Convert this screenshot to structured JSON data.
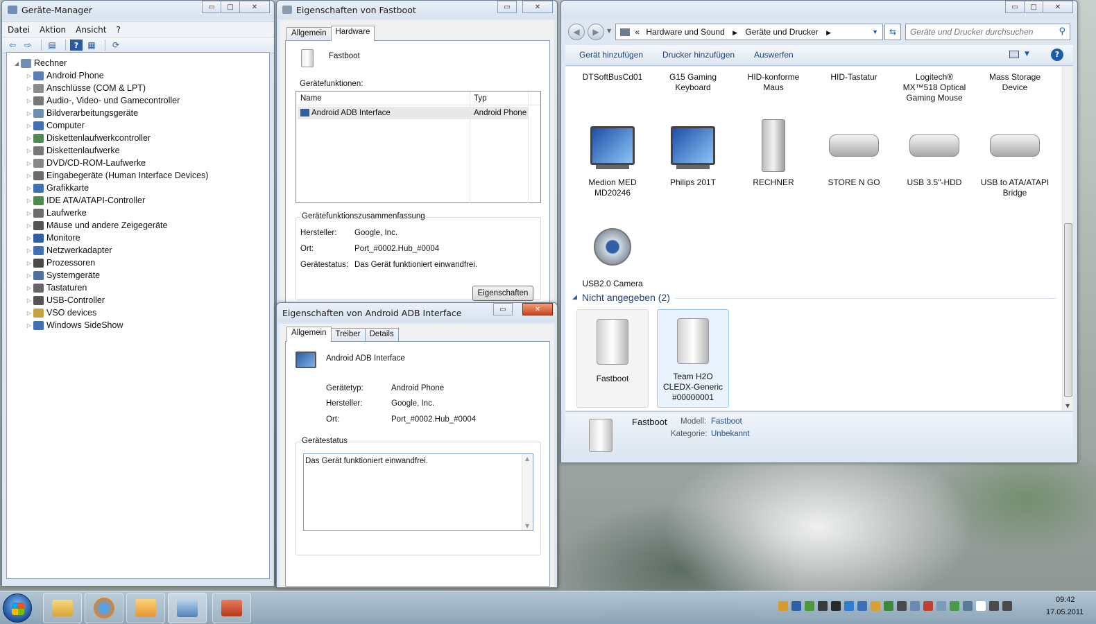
{
  "device_manager": {
    "title": "Geräte-Manager",
    "menu": [
      "Datei",
      "Aktion",
      "Ansicht",
      "?"
    ],
    "root": "Rechner",
    "items": [
      {
        "label": "Android Phone",
        "icon": "android-phone-icon",
        "color": "#5a7fb3"
      },
      {
        "label": "Anschlüsse (COM & LPT)",
        "icon": "port-icon",
        "color": "#8a8a8a"
      },
      {
        "label": "Audio-, Video- und Gamecontroller",
        "icon": "speaker-icon",
        "color": "#777777"
      },
      {
        "label": "Bildverarbeitungsgeräte",
        "icon": "camera-icon",
        "color": "#6d8fb4"
      },
      {
        "label": "Computer",
        "icon": "computer-icon",
        "color": "#3f6fb5"
      },
      {
        "label": "Diskettenlaufwerkcontroller",
        "icon": "controller-icon",
        "color": "#4f8a4f"
      },
      {
        "label": "Diskettenlaufwerke",
        "icon": "floppy-icon",
        "color": "#777777"
      },
      {
        "label": "DVD/CD-ROM-Laufwerke",
        "icon": "disc-drive-icon",
        "color": "#888888"
      },
      {
        "label": "Eingabegeräte (Human Interface Devices)",
        "icon": "hid-icon",
        "color": "#6b6b6b"
      },
      {
        "label": "Grafikkarte",
        "icon": "display-adapter-icon",
        "color": "#3f6fb5"
      },
      {
        "label": "IDE ATA/ATAPI-Controller",
        "icon": "ide-icon",
        "color": "#4f8a4f"
      },
      {
        "label": "Laufwerke",
        "icon": "drive-icon",
        "color": "#6d6d6d"
      },
      {
        "label": "Mäuse und andere Zeigegeräte",
        "icon": "mouse-icon",
        "color": "#555555"
      },
      {
        "label": "Monitore",
        "icon": "monitor-icon",
        "color": "#2f5fa5"
      },
      {
        "label": "Netzwerkadapter",
        "icon": "network-icon",
        "color": "#3f6fb5"
      },
      {
        "label": "Prozessoren",
        "icon": "processor-icon",
        "color": "#4a4a4a"
      },
      {
        "label": "Systemgeräte",
        "icon": "system-icon",
        "color": "#4f6f9f"
      },
      {
        "label": "Tastaturen",
        "icon": "keyboard-icon",
        "color": "#666666"
      },
      {
        "label": "USB-Controller",
        "icon": "usb-icon",
        "color": "#555555"
      },
      {
        "label": "VSO devices",
        "icon": "vso-icon",
        "color": "#c7a040"
      },
      {
        "label": "Windows SideShow",
        "icon": "sideshow-icon",
        "color": "#3f6fb5"
      }
    ]
  },
  "fastboot_props": {
    "title": "Eigenschaften von Fastboot",
    "tabs": [
      "Allgemein",
      "Hardware"
    ],
    "device_name": "Fastboot",
    "functions_label": "Gerätefunktionen:",
    "col_name": "Name",
    "col_type": "Typ",
    "row_name": "Android ADB Interface",
    "row_type": "Android Phone",
    "summary_title": "Gerätefunktionszusammenfassung",
    "manufacturer_label": "Hersteller:",
    "manufacturer": "Google, Inc.",
    "location_label": "Ort:",
    "location": "Port_#0002.Hub_#0004",
    "status_label": "Gerätestatus:",
    "status": "Das Gerät funktioniert einwandfrei.",
    "properties_button": "Eigenschaften"
  },
  "adb_props": {
    "title": "Eigenschaften von Android ADB Interface",
    "tabs": [
      "Allgemein",
      "Treiber",
      "Details"
    ],
    "device_name": "Android ADB Interface",
    "type_label": "Gerätetyp:",
    "type": "Android Phone",
    "manufacturer_label": "Hersteller:",
    "manufacturer": "Google, Inc.",
    "location_label": "Ort:",
    "location": "Port_#0002.Hub_#0004",
    "status_group": "Gerätestatus",
    "status_text": "Das Gerät funktioniert einwandfrei."
  },
  "devices_printers": {
    "breadcrumb": [
      "Hardware und Sound",
      "Geräte und Drucker"
    ],
    "search_placeholder": "Geräte und Drucker durchsuchen",
    "commands": [
      "Gerät hinzufügen",
      "Drucker hinzufügen",
      "Auswerfen"
    ],
    "top_row": [
      "DTSoftBusCd01",
      "G15 Gaming Keyboard",
      "HID-konforme Maus",
      "HID-Tastatur",
      "Logitech® MX™518 Optical Gaming Mouse",
      "Mass Storage Device"
    ],
    "devices": [
      "Medion MED MD20246",
      "Philips 201T",
      "RECHNER",
      "STORE N GO",
      "USB 3.5\"-HDD",
      "USB to ATA/ATAPI Bridge",
      "USB2.0 Camera"
    ],
    "unspecified_header": "Nicht angegeben (2)",
    "unspecified": [
      "Fastboot",
      "Team H2O CLEDX-Generic #00000001"
    ],
    "details_name": "Fastboot",
    "model_label": "Modell:",
    "model": "Fastboot",
    "category_label": "Kategorie:",
    "category": "Unbekannt"
  },
  "taskbar": {
    "time": "09:42",
    "date": "17.05.2011"
  },
  "colors": {
    "accent": "#1e5aa8",
    "link": "#1f4f8f"
  }
}
